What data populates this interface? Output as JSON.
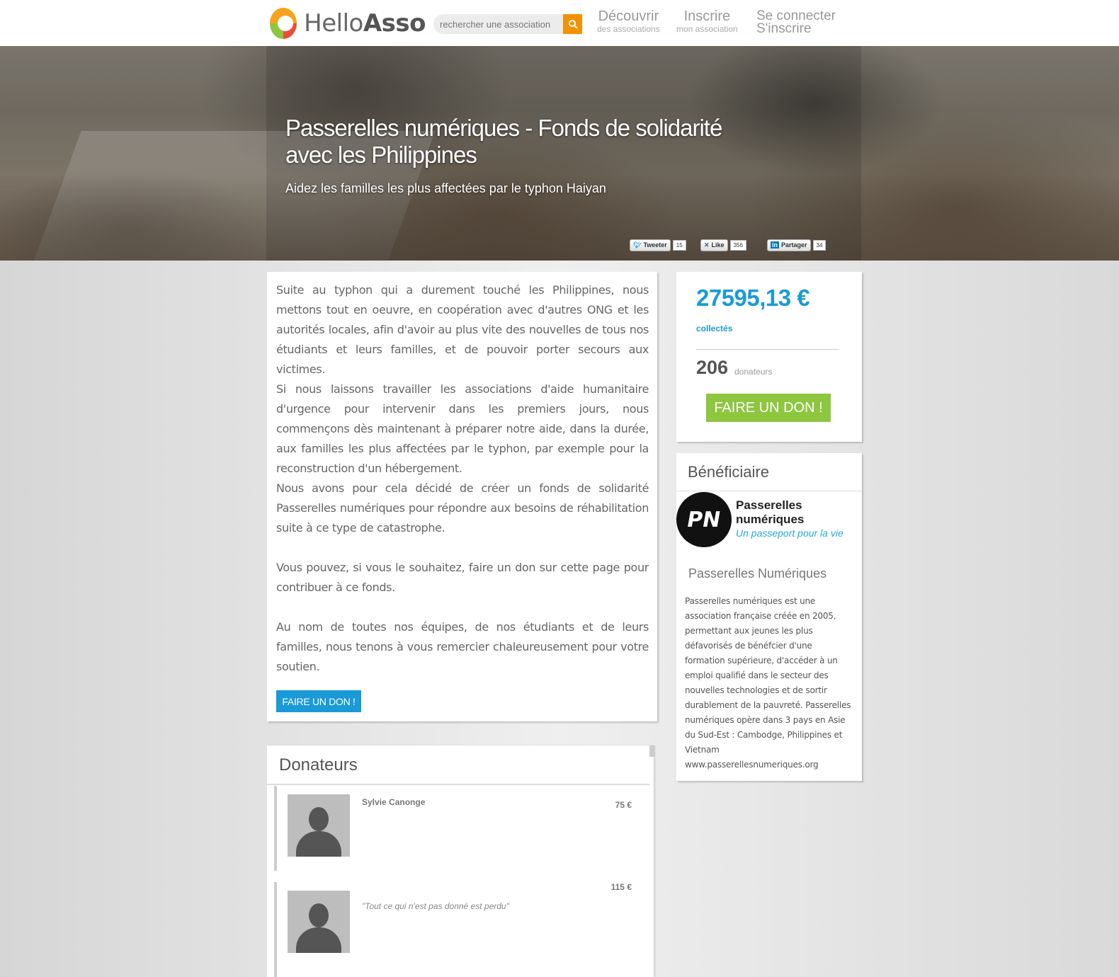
{
  "header": {
    "logo_hello": "Hello",
    "logo_asso": "Asso",
    "search_placeholder": "rechercher une association",
    "nav": [
      {
        "big": "Découvrir",
        "small": "des associations"
      },
      {
        "big": "Inscrire",
        "small": "mon association"
      }
    ],
    "connect": "Se connecter",
    "signup": "S'inscrire"
  },
  "hero": {
    "title": "Passerelles numériques - Fonds de solidarité avec les Philippines",
    "subtitle": "Aidez les familles les plus affectées par le typhon Haiyan",
    "social": [
      {
        "label": "Tweeter",
        "count": "15"
      },
      {
        "label": "Like",
        "count": "356"
      },
      {
        "label": "Partager",
        "count": "34"
      }
    ]
  },
  "description": {
    "paragraphs": [
      "Suite au typhon qui a durement touché les Philippines, nous mettons tout en oeuvre, en coopération avec d'autres ONG et les autorités locales, afin d'avoir au plus vite des nouvelles de tous nos étudiants et leurs familles, et de pouvoir porter secours aux victimes.",
      "Si nous laissons travailler les associations d'aide humanitaire d'urgence pour intervenir dans les premiers jours, nous commençons dès maintenant à préparer notre aide, dans la durée, aux familles les plus affectées par le typhon, par exemple pour la reconstruction d'un hébergement.",
      "Nous avons pour cela décidé de créer un fonds de solidarité Passerelles numériques pour répondre aux besoins de réhabilitation suite à ce type de catastrophe.",
      "Vous pouvez, si vous le souhaitez, faire un don sur cette page pour contribuer à ce fonds.",
      "Au nom de toutes nos équipes, de nos étudiants et de leurs familles, nous tenons à vous remercier chaleureusement pour votre soutien."
    ],
    "button": "FAIRE UN DON !"
  },
  "stats": {
    "amount": "27595,13 €",
    "collected_label": "collectés",
    "donors_count": "206",
    "donors_label": "donateurs",
    "button": "FAIRE UN DON !"
  },
  "beneficiary": {
    "title": "Bénéficiaire",
    "logo_text": "PN",
    "logo_name": "Passerelles numériques",
    "logo_tagline": "Un passeport pour la vie",
    "org_name": "Passerelles Numériques",
    "org_description": "Passerelles numériques est une association française créée en 2005, permettant aux jeunes les plus défavorisés de bénéfcier d'une formation supérieure, d'accéder à un emploi qualifié dans le secteur des nouvelles technologies et de sortir durablement de la pauvreté. Passerelles numériques opère dans 3 pays en Asie du Sud-Est : Cambodge, Philippines et Vietnam www.passerellesnumeriques.org"
  },
  "donors": {
    "title": "Donateurs",
    "list": [
      {
        "name": "Sylvie Canonge",
        "amount": "75 €",
        "message": ""
      },
      {
        "name": "",
        "amount": "115 €",
        "message": "\"Tout ce qui n'est pas donné est perdu\""
      }
    ]
  }
}
